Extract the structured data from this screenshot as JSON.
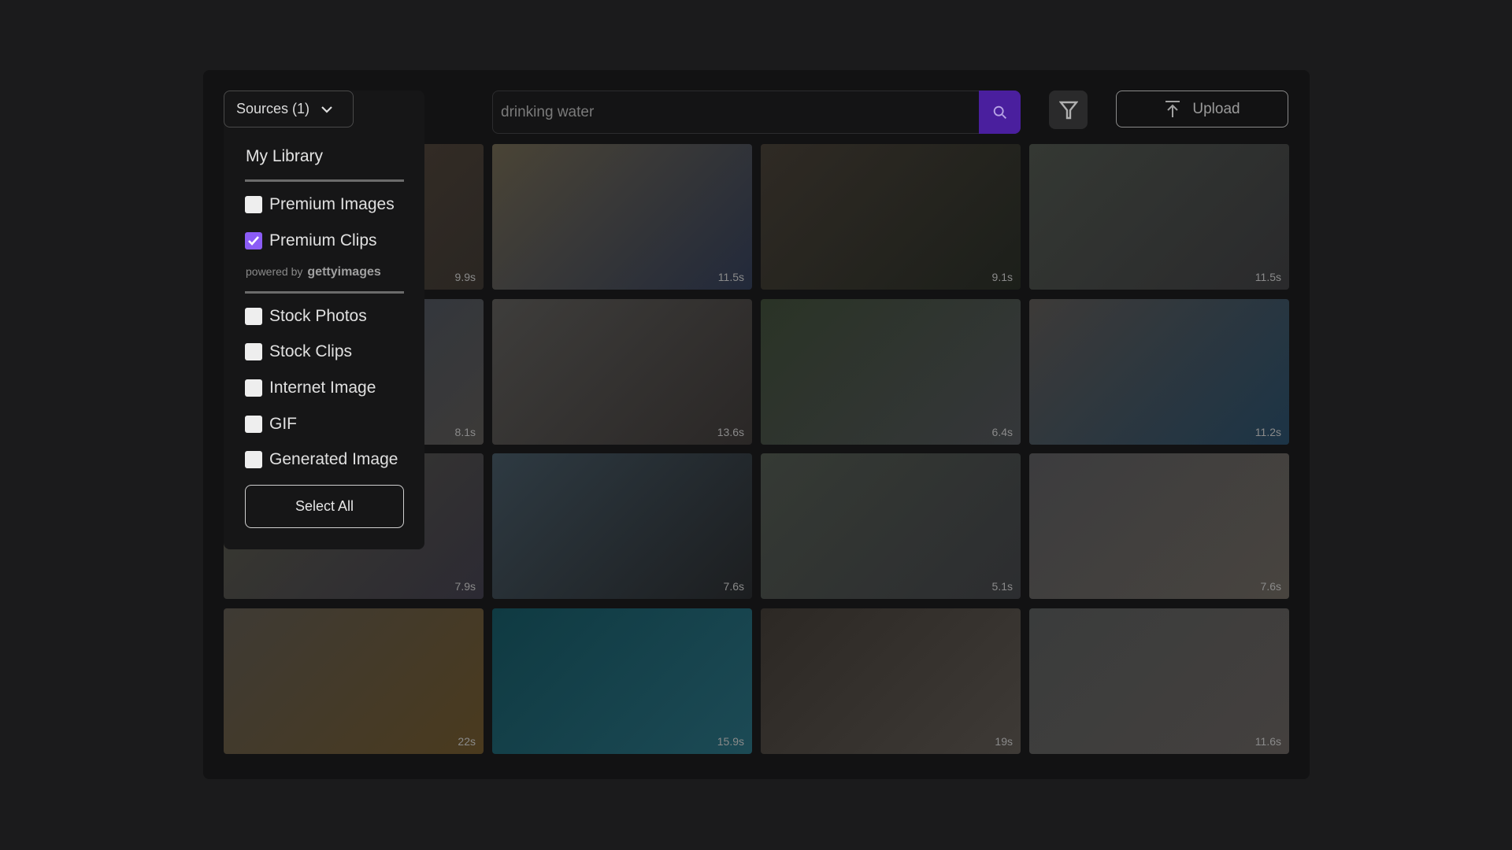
{
  "search": {
    "value": "drinking water"
  },
  "toolbar": {
    "upload_label": "Upload",
    "search_icon": "search-icon",
    "filter_icon": "filter-icon",
    "upload_icon": "upload-icon"
  },
  "sources": {
    "button_label": "Sources (1)",
    "library_label": "My Library",
    "powered_by": "powered by",
    "powered_brand": "gettyimages",
    "premium": [
      {
        "label": "Premium Images",
        "checked": false
      },
      {
        "label": "Premium Clips",
        "checked": true
      }
    ],
    "others": [
      {
        "label": "Stock Photos",
        "checked": false
      },
      {
        "label": "Stock Clips",
        "checked": false
      },
      {
        "label": "Internet Image",
        "checked": false
      },
      {
        "label": "GIF",
        "checked": false
      },
      {
        "label": "Generated Image",
        "checked": false
      }
    ],
    "select_all": "Select All"
  },
  "accent": "#8b5cf6",
  "grid": [
    [
      "9.9s",
      "11.5s",
      "9.1s",
      "11.5s"
    ],
    [
      "8.1s",
      "13.6s",
      "6.4s",
      "11.2s"
    ],
    [
      "7.9s",
      "7.6s",
      "5.1s",
      "7.6s"
    ],
    [
      "22s",
      "15.9s",
      "19s",
      "11.6s"
    ]
  ]
}
